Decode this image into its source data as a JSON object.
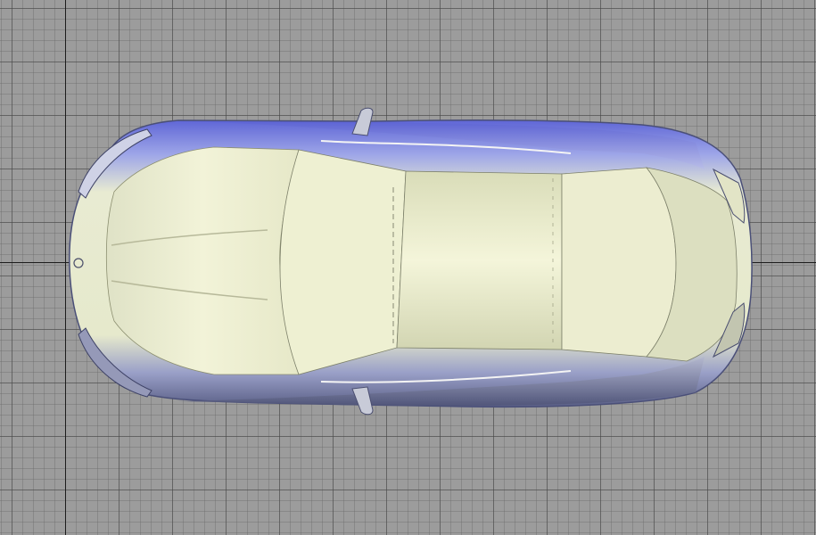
{
  "viewport": {
    "view": "top-orthographic",
    "model": "car-top-view",
    "grid_visible": true,
    "axes_visible": true
  },
  "colors": {
    "background": "#9c9c9c",
    "grid_major": "#5a5a5a",
    "axis": "#1c1c1c",
    "body_light": "#eef0d0",
    "body_blue": "#6e74d8",
    "body_shadow": "#55597a"
  }
}
